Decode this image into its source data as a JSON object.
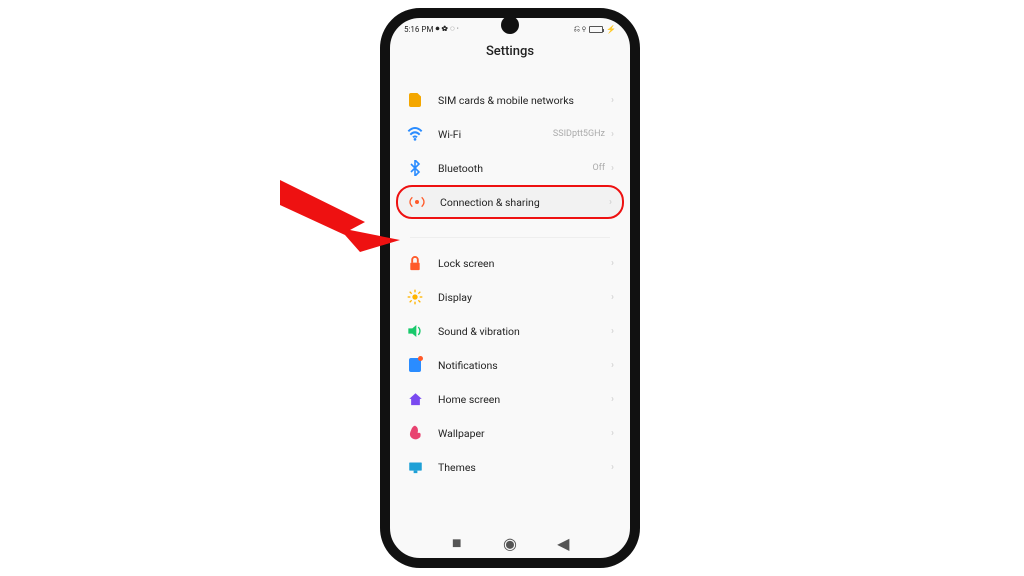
{
  "status_bar": {
    "time": "5:16 PM",
    "indicators": "⏺ ✿ ◌ ·",
    "right_icons": "⎌ ⚲"
  },
  "header": {
    "title": "Settings"
  },
  "groups": [
    {
      "items": [
        {
          "icon": "sim-icon",
          "label": "SIM cards & mobile networks",
          "value": ""
        },
        {
          "icon": "wifi-icon",
          "label": "Wi-Fi",
          "value": "SSIDptt5GHz"
        },
        {
          "icon": "bluetooth-icon",
          "label": "Bluetooth",
          "value": "Off"
        },
        {
          "icon": "connection-sharing-icon",
          "label": "Connection & sharing",
          "value": "",
          "highlight": true
        }
      ]
    },
    {
      "items": [
        {
          "icon": "lock-icon",
          "label": "Lock screen",
          "value": ""
        },
        {
          "icon": "display-icon",
          "label": "Display",
          "value": ""
        },
        {
          "icon": "sound-icon",
          "label": "Sound & vibration",
          "value": ""
        },
        {
          "icon": "notifications-icon",
          "label": "Notifications",
          "value": ""
        },
        {
          "icon": "home-icon",
          "label": "Home screen",
          "value": ""
        },
        {
          "icon": "wallpaper-icon",
          "label": "Wallpaper",
          "value": ""
        },
        {
          "icon": "themes-icon",
          "label": "Themes",
          "value": ""
        }
      ]
    }
  ],
  "nav": {
    "recent": "■",
    "home": "◉",
    "back": "◀"
  },
  "annotation": {
    "arrow_target": "Connection & sharing"
  },
  "icon_colors": {
    "sim-icon": "#f4a700",
    "wifi-icon": "#2a8cff",
    "bluetooth-icon": "#2a8cff",
    "connection-sharing-icon": "#ff5a2a",
    "lock-icon": "#ff5a2a",
    "display-icon": "#ffb400",
    "sound-icon": "#18c96b",
    "notifications-icon": "#2a8cff",
    "home-icon": "#7a4af0",
    "wallpaper-icon": "#e84370",
    "themes-icon": "#1ea0d6"
  }
}
